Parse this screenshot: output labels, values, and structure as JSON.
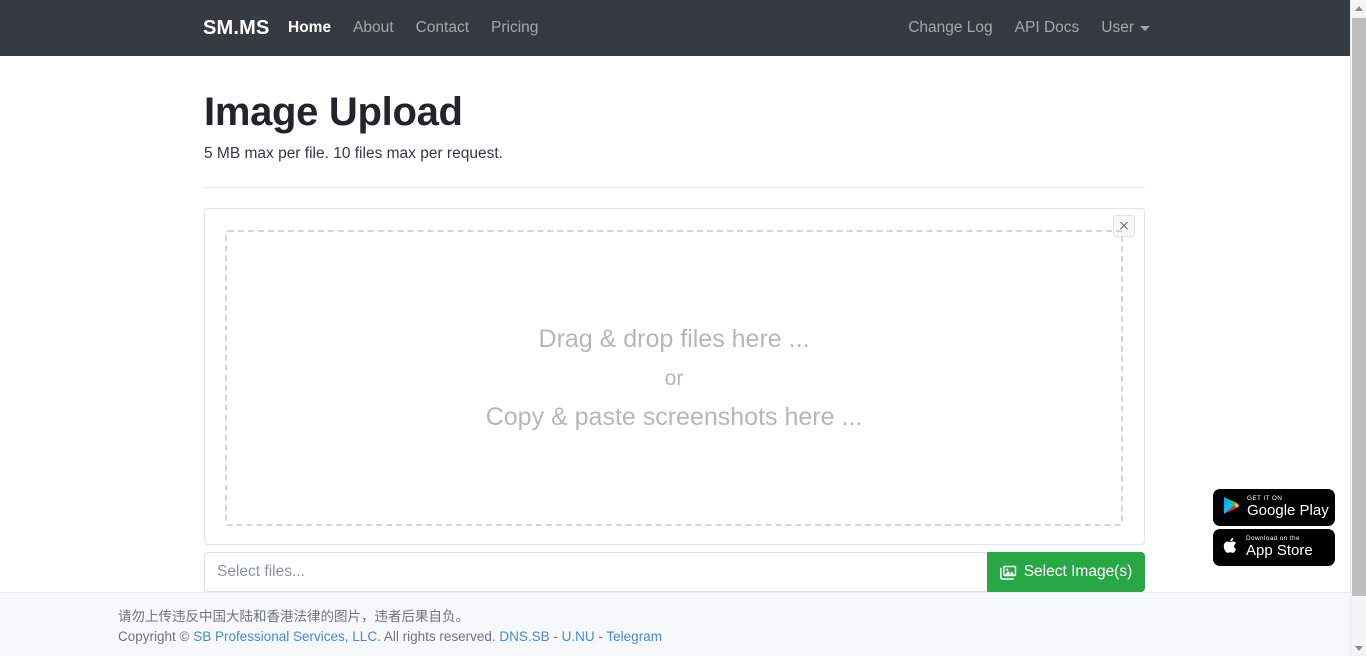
{
  "navbar": {
    "brand": "SM.MS",
    "left_links": [
      {
        "label": "Home",
        "active": true
      },
      {
        "label": "About",
        "active": false
      },
      {
        "label": "Contact",
        "active": false
      },
      {
        "label": "Pricing",
        "active": false
      }
    ],
    "right_links": [
      {
        "label": "Change Log"
      },
      {
        "label": "API Docs"
      }
    ],
    "user_menu": {
      "label": "User",
      "icon": "chevron-down-icon"
    },
    "background_color": "#343a40"
  },
  "main": {
    "title": "Image Upload",
    "subtitle": "5 MB max per file. 10 files max per request.",
    "upload_card": {
      "close_label": "×",
      "dropzone": {
        "line1": "Drag & drop files here ...",
        "line2": "or",
        "line3": "Copy & paste screenshots here ..."
      }
    },
    "file_group": {
      "input_value": "",
      "input_placeholder": "Select files...",
      "button_label": "Select Image(s)",
      "button_icon": "image-icon",
      "button_color": "#28a745"
    }
  },
  "footer": {
    "notice": "请勿上传违反中国大陆和香港法律的图片，违者后果自负。",
    "copyright_prefix": "Copyright © ",
    "company": "SB Professional Services, LLC",
    "rights": ". All rights reserved. ",
    "links": [
      {
        "label": "DNS.SB"
      },
      {
        "label": "U.NU"
      },
      {
        "label": "Telegram"
      }
    ],
    "link_separator": " - ",
    "link_color": "#4a88d8"
  },
  "badges": [
    {
      "top": "GET IT ON",
      "main": "Google Play",
      "icon": "google-play-icon"
    },
    {
      "top": "Download on the",
      "main": "App Store",
      "icon": "apple-icon"
    }
  ],
  "scrollbar": {
    "up_icon": "caret-up-icon",
    "down_icon": "caret-down-icon"
  }
}
